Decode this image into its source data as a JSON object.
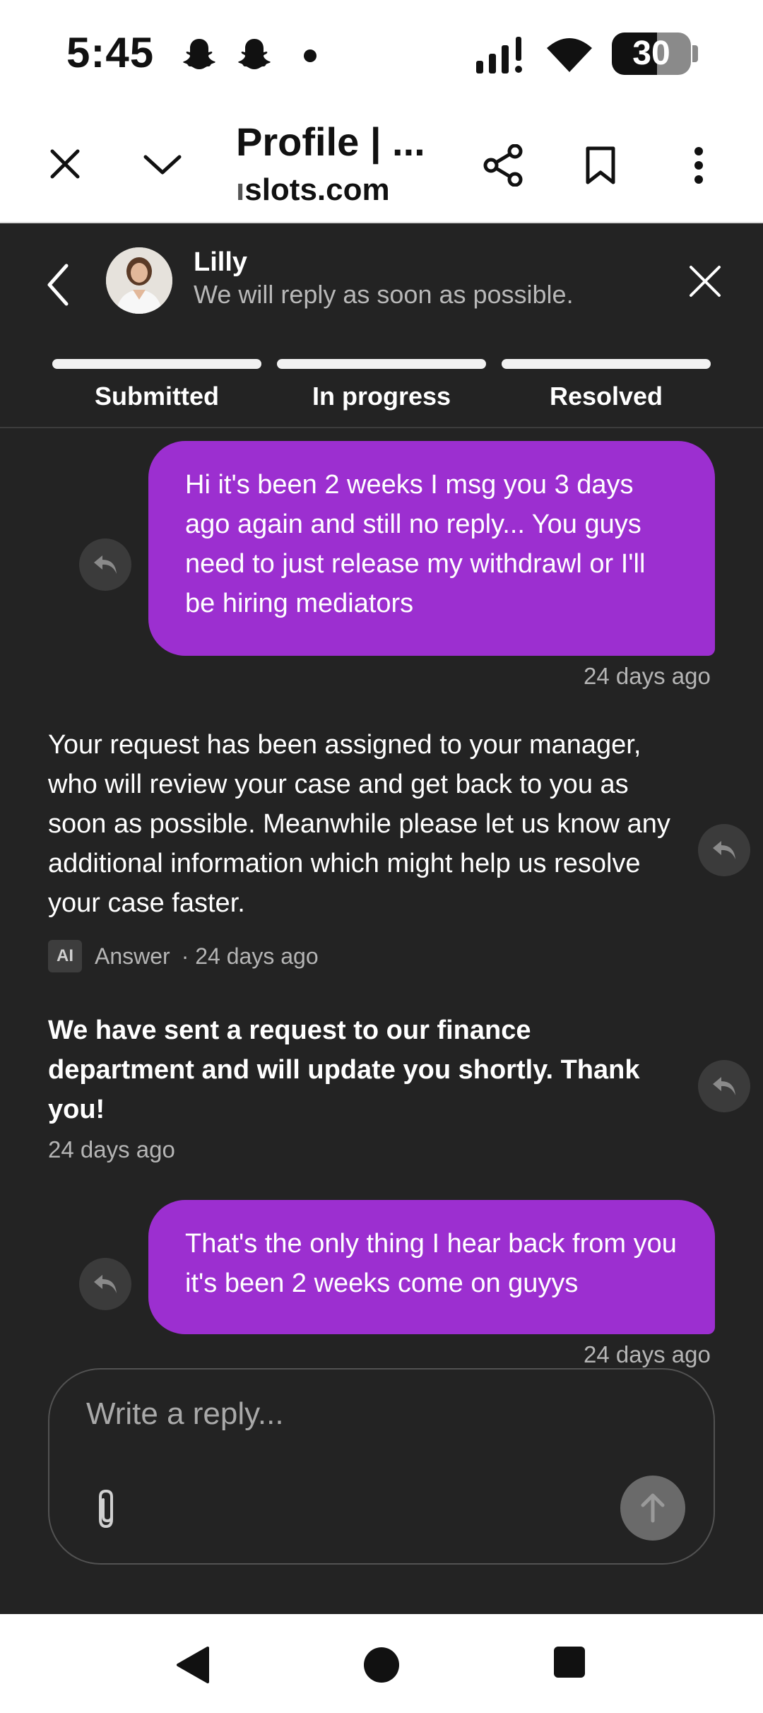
{
  "status_bar": {
    "time": "5:45",
    "battery": "30",
    "battery_level": 0.3,
    "icons": [
      "snapchat-ghost-icon",
      "snapchat-ghost-icon",
      "notification-dot-icon",
      "signal-icon",
      "wifi-icon",
      "battery-icon"
    ]
  },
  "browser": {
    "title": "Profile | ...",
    "url_partial": "ı",
    "url_main": "slots.com",
    "icons": [
      "close-icon",
      "chevron-down-icon",
      "share-icon",
      "bookmark-icon",
      "more-vert-icon"
    ]
  },
  "chat": {
    "agent_name": "Lilly",
    "agent_status": "We will reply as soon as possible.",
    "steps": [
      "Submitted",
      "In progress",
      "Resolved"
    ],
    "messages": [
      {
        "from": "user",
        "text": "Hi it's been 2 weeks I msg you 3 days ago again and still no reply... You guys need to just release my withdrawl or I'll be hiring mediators",
        "time": "24 days ago"
      },
      {
        "from": "agent",
        "text": "Your request has been assigned to your manager, who will review your case and get back to you as soon as possible. Meanwhile please let us know any additional information which might help us resolve your case faster.",
        "badge": "AI",
        "label": "Answer",
        "time": "· 24 days ago"
      },
      {
        "from": "agent",
        "text": "We have sent a request to our finance department and will update you shortly. Thank you!",
        "time": "24 days ago"
      },
      {
        "from": "user",
        "text": "That's the only thing I hear back from you it's been 2 weeks come on guyys",
        "time": "24 days ago"
      }
    ],
    "composer": {
      "placeholder": "Write a reply..."
    }
  },
  "colors": {
    "background": "#232323",
    "user_bubble": "#9c2fd0",
    "muted_text": "#b5b5b5"
  }
}
